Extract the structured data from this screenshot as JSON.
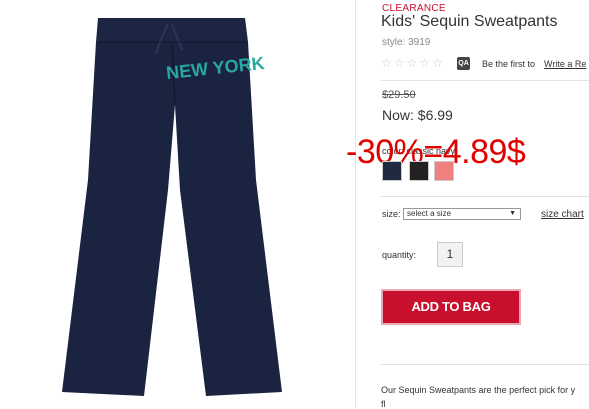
{
  "product": {
    "badge": "CLEARANCE",
    "title": "Kids' Sequin Sweatpants",
    "style": "style: 3919",
    "image_text": "NEW YORK"
  },
  "reviews": {
    "stars": [
      "☆",
      "☆",
      "☆",
      "☆",
      "☆"
    ],
    "qa_icon_label": "QA",
    "be_first": "Be the first to",
    "write_review": "Write a Re"
  },
  "pricing": {
    "original": "$29.50",
    "now": "Now: $6.99",
    "overlay_discount": "-30%=4.89$"
  },
  "color": {
    "label": "color: classic navy",
    "swatches": [
      {
        "name": "classic navy",
        "color": "#1f2a40"
      },
      {
        "name": "black",
        "color": "#222222"
      },
      {
        "name": "pink",
        "color": "#f08080"
      }
    ]
  },
  "size": {
    "label": "size:",
    "selected": "select a size",
    "chart_link": "size chart"
  },
  "quantity": {
    "label": "quantity:",
    "value": "1"
  },
  "cart": {
    "button_label": "ADD TO BAG"
  },
  "description": {
    "line1": "Our Sequin Sweatpants are the perfect pick for y",
    "line2": "fl                                              "
  },
  "colors": {
    "accent": "#c8102e",
    "pants": "#1a2340",
    "sequin": "#2aa7a0",
    "discount": "#e00000"
  }
}
